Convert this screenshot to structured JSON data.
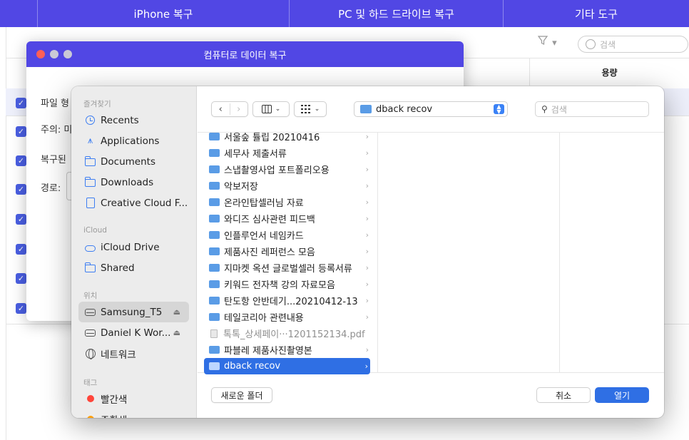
{
  "topnav": {
    "tabs": [
      "iPhone 복구",
      "PC 및 하드 드라이브 복구",
      "기타 도구"
    ]
  },
  "background": {
    "filter_label": "▾",
    "search_placeholder": "검색",
    "column_size": "용량"
  },
  "dialog": {
    "title": "컴퓨터로 데이터 복구",
    "labels": [
      "파일 형",
      "주의: 미",
      "복구된",
      "경로:"
    ]
  },
  "finder": {
    "sidebar": {
      "favorites_header": "즐겨찾기",
      "favorites": [
        "Recents",
        "Applications",
        "Documents",
        "Downloads",
        "Creative Cloud F..."
      ],
      "icloud_header": "iCloud",
      "icloud": [
        "iCloud Drive",
        "Shared"
      ],
      "locations_header": "위치",
      "locations": [
        "Samsung_T5",
        "Daniel K Wor...",
        "네트워크"
      ],
      "tags_header": "태그",
      "tags": [
        "빨간색",
        "주황색"
      ],
      "tag_colors": [
        "#ff453a",
        "#ff9f0a"
      ]
    },
    "toolbar": {
      "current_folder": "dback recov",
      "search_placeholder": "검색"
    },
    "files": [
      "서울숲 튤립 20210416",
      "세무사 제출서류",
      "스냅촬영사업 포트폴리오용",
      "악보저장",
      "온라인탑셀러님 자료",
      "와디즈 심사관련 피드백",
      "인플루언서 네임카드",
      "제품사진 레퍼런스 모음",
      "지마켓 옥션 글로벌셀러 등록서류",
      "키워드 전자책 강의 자료모음",
      "탄도항 안반데기...20210412-13",
      "테일코리아 관련내용",
      "톡톡_상세페이···1201152134.pdf",
      "파블레 제품사진촬영본",
      "dback recov"
    ],
    "buttons": {
      "new_folder": "새로운 폴더",
      "cancel": "취소",
      "open": "열기"
    }
  }
}
